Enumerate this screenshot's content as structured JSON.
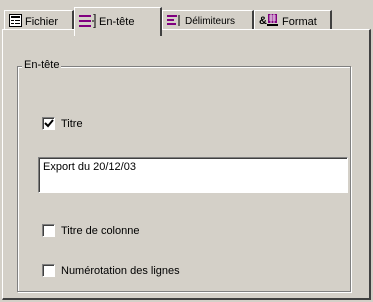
{
  "tabs": [
    {
      "label": "Fichier",
      "icon": "document-icon",
      "active": false
    },
    {
      "label": "En-tête",
      "icon": "header-lines-icon",
      "active": true
    },
    {
      "label": "Délimiteurs",
      "icon": "delimiter-lines-icon",
      "active": false
    },
    {
      "label": "Format",
      "icon": "format-icon",
      "active": false
    }
  ],
  "group": {
    "legend": "En-tête",
    "titre": {
      "label": "Titre",
      "checked": true
    },
    "title_value": "Export du 20/12/03",
    "col_title": {
      "label": "Titre de colonne",
      "checked": false
    },
    "line_numbering": {
      "label": "Numérotation des lignes",
      "checked": false
    }
  },
  "colors": {
    "face": "#d4d0c8",
    "shadow": "#808080",
    "dark": "#404040",
    "highlight": "#ffffff",
    "accent": "#800080"
  }
}
